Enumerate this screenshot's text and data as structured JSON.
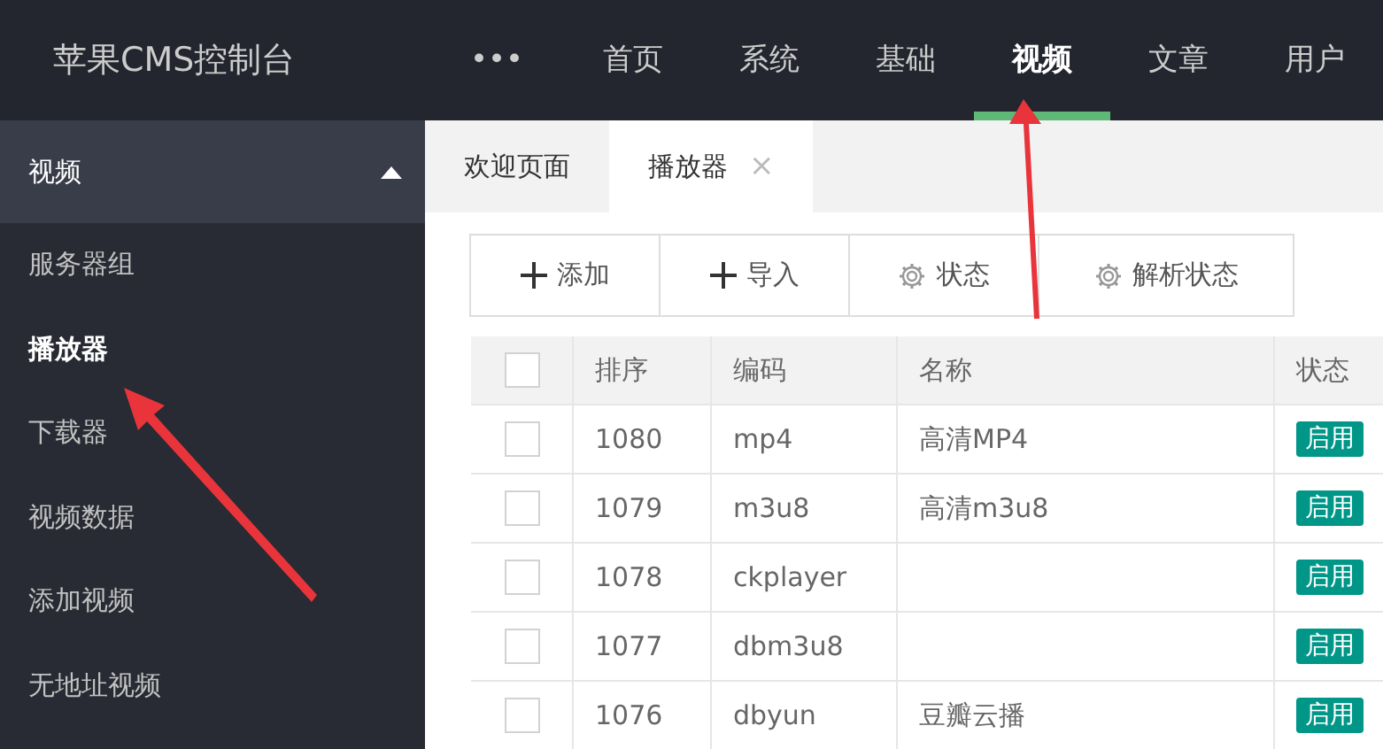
{
  "header": {
    "logo": "苹果CMS控制台",
    "nav": [
      {
        "label": "•••",
        "selected": false
      },
      {
        "label": "首页",
        "selected": false
      },
      {
        "label": "系统",
        "selected": false
      },
      {
        "label": "基础",
        "selected": false
      },
      {
        "label": "视频",
        "selected": true
      },
      {
        "label": "文章",
        "selected": false
      },
      {
        "label": "用户",
        "selected": false
      }
    ]
  },
  "sidebar": {
    "title": "视频",
    "expanded": true,
    "items": [
      {
        "label": "服务器组",
        "selected": false
      },
      {
        "label": "播放器",
        "selected": true
      },
      {
        "label": "下载器",
        "selected": false
      },
      {
        "label": "视频数据",
        "selected": false
      },
      {
        "label": "添加视频",
        "selected": false
      },
      {
        "label": "无地址视频",
        "selected": false
      }
    ]
  },
  "tabs": [
    {
      "label": "欢迎页面",
      "selected": false
    },
    {
      "label": "播放器",
      "selected": true,
      "close": "×"
    }
  ],
  "toolbar": [
    {
      "label": "添加",
      "kind": "plus"
    },
    {
      "label": "导入",
      "kind": "plus"
    },
    {
      "label": "状态",
      "kind": "gear"
    },
    {
      "label": "解析状态",
      "kind": "gear"
    }
  ],
  "table": {
    "select_all_checked": false,
    "columns": [
      "排序",
      "编码",
      "名称",
      "状态"
    ],
    "rows": [
      {
        "order": "1080",
        "code": "mp4",
        "name": "高清MP4",
        "status": "启用",
        "checked": false
      },
      {
        "order": "1079",
        "code": "m3u8",
        "name": "高清m3u8",
        "status": "启用",
        "checked": false
      },
      {
        "order": "1078",
        "code": "ckplayer",
        "status": "启用",
        "checked": false
      },
      {
        "order": "1077",
        "code": "dbm3u8",
        "status": "启用",
        "checked": false
      },
      {
        "order": "1076",
        "code": "dbyun",
        "name": "豆瓣云播",
        "status": "启用",
        "checked": false
      }
    ]
  }
}
